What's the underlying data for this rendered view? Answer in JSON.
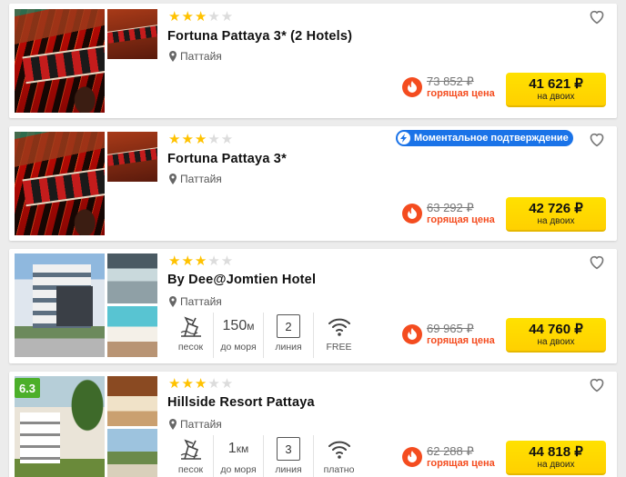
{
  "hotels": [
    {
      "stars": 3,
      "name": "Fortuna Pattaya 3* (2 Hotels)",
      "location": "Паттайя",
      "old_price": "73 852 ₽",
      "hot_label": "горящая цена",
      "price": "41 621 ₽",
      "price_sub": "на двоих",
      "favorite_icon": "heart-outline-icon"
    },
    {
      "stars": 3,
      "name": "Fortuna Pattaya 3*",
      "location": "Паттайя",
      "badge": "Моментальное подтверждение",
      "old_price": "63 292 ₽",
      "hot_label": "горящая цена",
      "price": "42 726 ₽",
      "price_sub": "на двоих",
      "favorite_icon": "heart-outline-icon"
    },
    {
      "stars": 3,
      "name": "By Dee@Jomtien Hotel",
      "location": "Паттайя",
      "amenities": {
        "beach": "песок",
        "distance_value": "150",
        "distance_unit": "м",
        "distance_caption": "до моря",
        "line_value": "2",
        "line_caption": "линия",
        "wifi_caption": "FREE"
      },
      "old_price": "69 965 ₽",
      "hot_label": "горящая цена",
      "price": "44 760 ₽",
      "price_sub": "на двоих",
      "favorite_icon": "heart-outline-icon"
    },
    {
      "stars": 3,
      "rating": "6.3",
      "name": "Hillside Resort Pattaya",
      "location": "Паттайя",
      "amenities": {
        "beach": "песок",
        "distance_value": "1",
        "distance_unit": "км",
        "distance_caption": "до моря",
        "line_value": "3",
        "line_caption": "линия",
        "wifi_caption": "платно"
      },
      "old_price": "62 288 ₽",
      "hot_label": "горящая цена",
      "price": "44 818 ₽",
      "price_sub": "на двоих",
      "favorite_icon": "heart-outline-icon"
    }
  ],
  "colors": {
    "star": "#ffc200",
    "price_button": "#ffd000",
    "hot": "#f44c1f",
    "instant_badge": "#1a73e8",
    "rating": "#4caf2a"
  }
}
